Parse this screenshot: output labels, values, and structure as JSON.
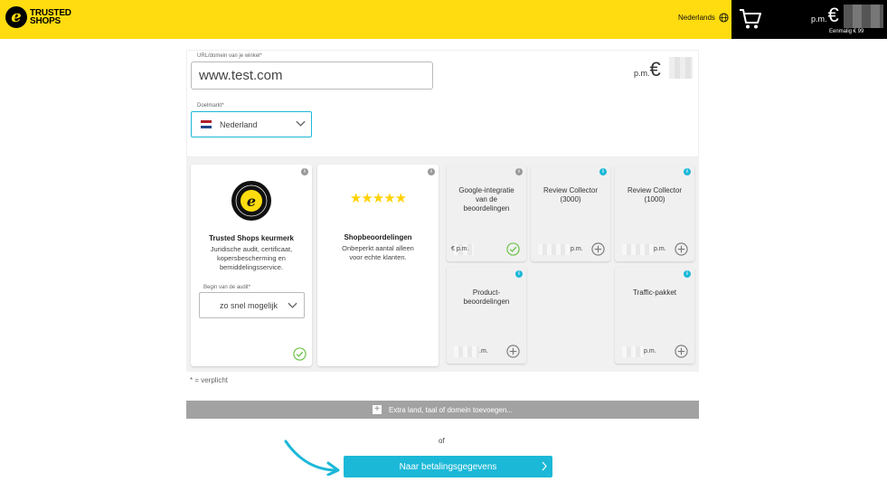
{
  "header": {
    "logo_line1": "TRUSTED",
    "logo_line2": "SHOPS",
    "language": "Nederlands",
    "cart_price_prefix": "p.m.",
    "currency_symbol": "€",
    "cart_subtext": "Eenmalig € 99"
  },
  "form": {
    "url_label": "URL/domein van je winkel*",
    "url_value": "www.test.com",
    "market_label": "Doelmarkt*",
    "market_value": "Nederland",
    "price_prefix": "p.m.",
    "currency_symbol": "€"
  },
  "cards": {
    "keurmerk": {
      "title": "Trusted Shops keurmerk",
      "desc": [
        "Juridische audit, certificaat,",
        "kopersbescherming en",
        "bemiddelingsservice."
      ],
      "audit_label": "Begin van de audit*",
      "audit_value": "zo snel mogelijk"
    },
    "shopbeoordelingen": {
      "stars": "★★★★★",
      "title": "Shopbeoordelingen",
      "desc": [
        "Onbeperkt aantal alleen",
        "voor echte klanten."
      ]
    },
    "google": {
      "title": [
        "Google-integratie",
        "van de",
        "beoordelingen"
      ],
      "price_suffix": "€ p.m."
    },
    "review3000": {
      "title": [
        "Review Collector",
        "(3000)"
      ],
      "price_suffix": "p.m."
    },
    "review1000": {
      "title": [
        "Review Collector",
        "(1000)"
      ],
      "price_suffix": "p.m."
    },
    "product": {
      "title": [
        "Product-",
        "beoordelingen"
      ],
      "price_suffix": ".m."
    },
    "traffic": {
      "title": "Traffic-pakket",
      "price_suffix": "p.m."
    }
  },
  "required_note": "* = verplicht",
  "add_bar_label": "Extra land, taal of domein toevoegen...",
  "or_text": "of",
  "pay_button_label": "Naar betalingsgegevens",
  "colors": {
    "brand_yellow": "#ffdc0f",
    "accent_blue": "#1cb8d8",
    "check_green": "#6cc24a"
  }
}
